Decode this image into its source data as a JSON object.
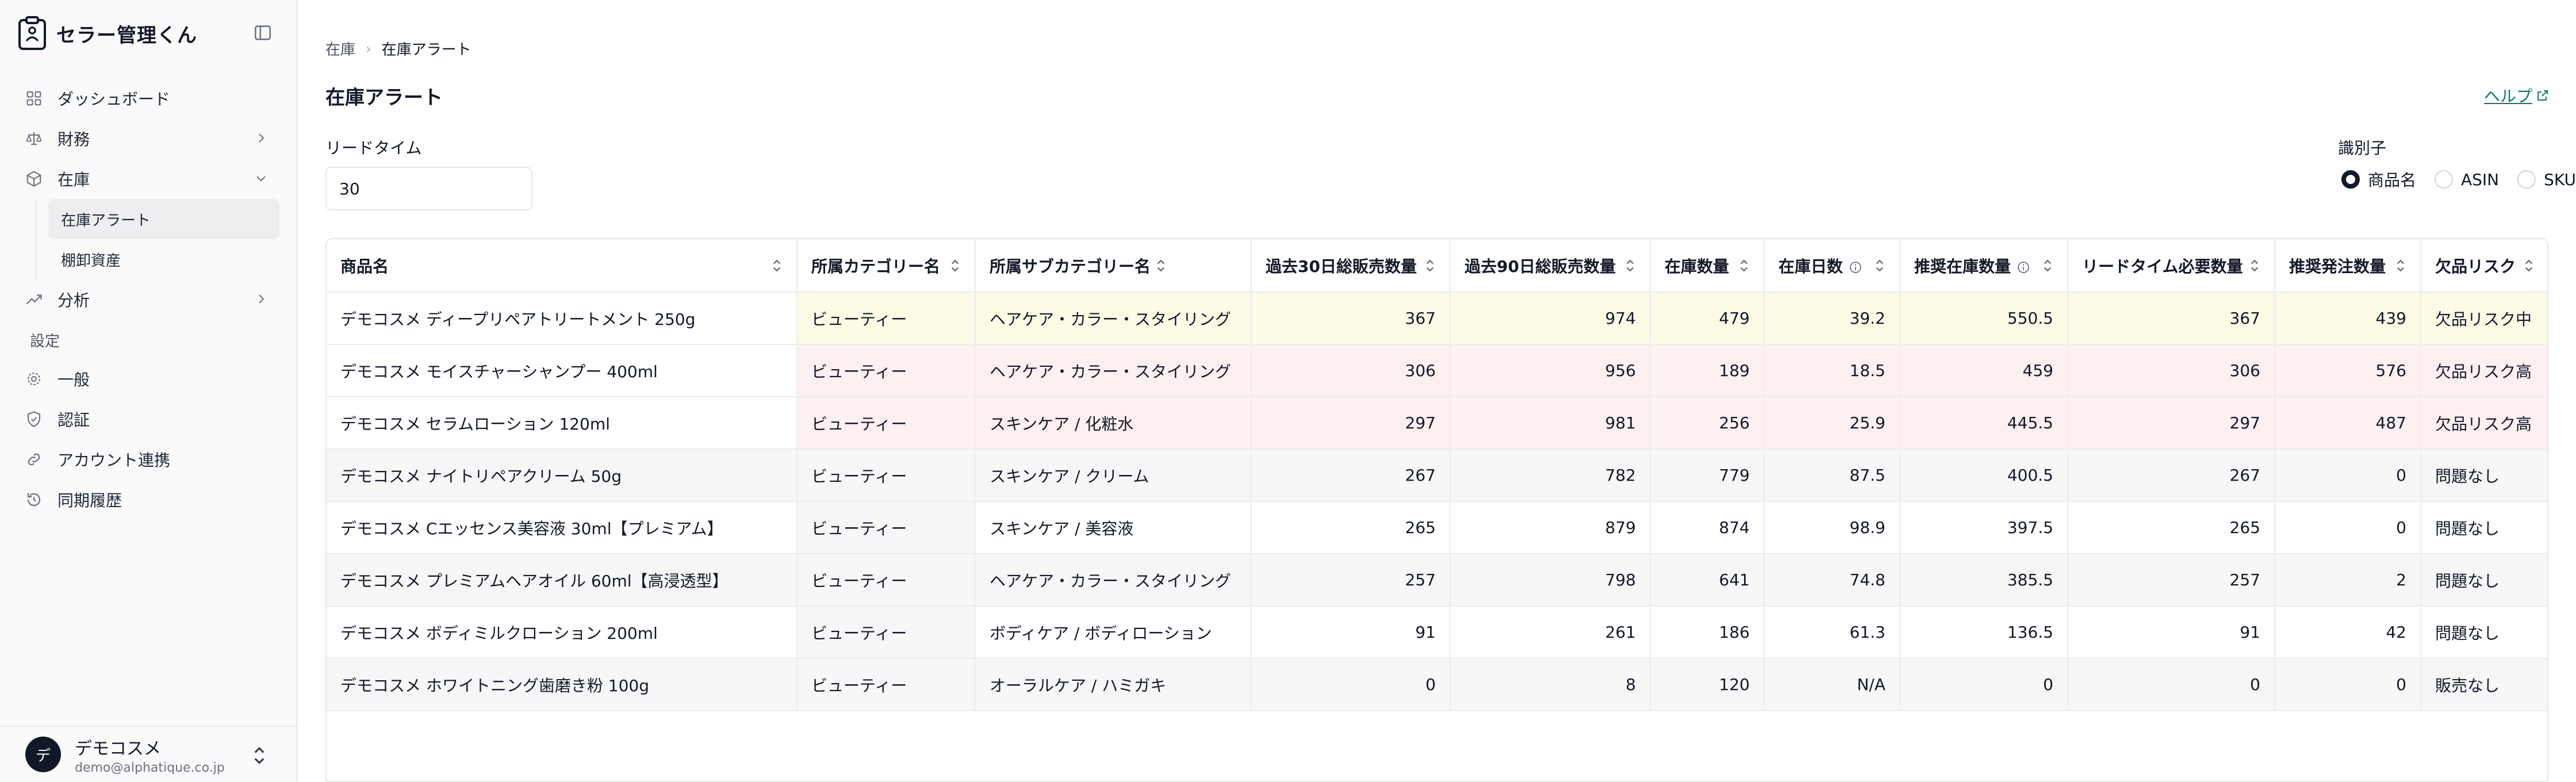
{
  "app": {
    "name": "セラー管理くん"
  },
  "sidebar": {
    "items": [
      {
        "label": "ダッシュボード",
        "icon": "grid-icon"
      },
      {
        "label": "財務",
        "icon": "scale-icon"
      },
      {
        "label": "在庫",
        "icon": "box-icon"
      },
      {
        "label": "分析",
        "icon": "trend-icon"
      }
    ],
    "inventory_sub": [
      {
        "label": "在庫アラート"
      },
      {
        "label": "棚卸資産"
      }
    ],
    "settings_heading": "設定",
    "settings_items": [
      {
        "label": "一般",
        "icon": "gear-icon"
      },
      {
        "label": "認証",
        "icon": "shield-icon"
      },
      {
        "label": "アカウント連携",
        "icon": "link-icon"
      },
      {
        "label": "同期履歴",
        "icon": "history-icon"
      }
    ]
  },
  "user": {
    "avatar_initial": "デ",
    "name": "デモコスメ",
    "email": "demo@alphatique.co.jp"
  },
  "breadcrumb": {
    "parent": "在庫",
    "separator": "›",
    "current": "在庫アラート"
  },
  "page": {
    "title": "在庫アラート",
    "help_label": "ヘルプ"
  },
  "lead_time": {
    "label": "リードタイム",
    "value": "30"
  },
  "identifier": {
    "label": "識別子",
    "options": [
      "商品名",
      "ASIN",
      "SKU"
    ],
    "selected": "商品名"
  },
  "table": {
    "headers": {
      "product": "商品名",
      "category": "所属カテゴリー名",
      "subcategory": "所属サブカテゴリー名",
      "sales30": "過去30日総販売数量",
      "sales90": "過去90日総販売数量",
      "stock": "在庫数量",
      "days": "在庫日数",
      "recommended": "推奨在庫数量",
      "leadtime_need": "リードタイム必要数量",
      "order": "推奨発注数量",
      "risk": "欠品リスク"
    },
    "rows": [
      {
        "product": "デモコスメ ディープリペアトリートメント 250g",
        "category": "ビューティー",
        "subcategory": "ヘアケア・カラー・スタイリング",
        "sales30": "367",
        "sales90": "974",
        "stock": "479",
        "days": "39.2",
        "recommended": "550.5",
        "leadtime_need": "367",
        "order": "439",
        "risk": "欠品リスク中",
        "level": "mid"
      },
      {
        "product": "デモコスメ モイスチャーシャンプー 400ml",
        "category": "ビューティー",
        "subcategory": "ヘアケア・カラー・スタイリング",
        "sales30": "306",
        "sales90": "956",
        "stock": "189",
        "days": "18.5",
        "recommended": "459",
        "leadtime_need": "306",
        "order": "576",
        "risk": "欠品リスク高",
        "level": "high"
      },
      {
        "product": "デモコスメ セラムローション 120ml",
        "category": "ビューティー",
        "subcategory": "スキンケア / 化粧水",
        "sales30": "297",
        "sales90": "981",
        "stock": "256",
        "days": "25.9",
        "recommended": "445.5",
        "leadtime_need": "297",
        "order": "487",
        "risk": "欠品リスク高",
        "level": "high"
      },
      {
        "product": "デモコスメ ナイトリペアクリーム 50g",
        "category": "ビューティー",
        "subcategory": "スキンケア / クリーム",
        "sales30": "267",
        "sales90": "782",
        "stock": "779",
        "days": "87.5",
        "recommended": "400.5",
        "leadtime_need": "267",
        "order": "0",
        "risk": "問題なし",
        "level": "alt"
      },
      {
        "product": "デモコスメ Cエッセンス美容液 30ml【プレミアム】",
        "category": "ビューティー",
        "subcategory": "スキンケア / 美容液",
        "sales30": "265",
        "sales90": "879",
        "stock": "874",
        "days": "98.9",
        "recommended": "397.5",
        "leadtime_need": "265",
        "order": "0",
        "risk": "問題なし",
        "level": "plain"
      },
      {
        "product": "デモコスメ プレミアムヘアオイル 60ml【高浸透型】",
        "category": "ビューティー",
        "subcategory": "ヘアケア・カラー・スタイリング",
        "sales30": "257",
        "sales90": "798",
        "stock": "641",
        "days": "74.8",
        "recommended": "385.5",
        "leadtime_need": "257",
        "order": "2",
        "risk": "問題なし",
        "level": "alt"
      },
      {
        "product": "デモコスメ ボディミルクローション 200ml",
        "category": "ビューティー",
        "subcategory": "ボディケア / ボディローション",
        "sales30": "91",
        "sales90": "261",
        "stock": "186",
        "days": "61.3",
        "recommended": "136.5",
        "leadtime_need": "91",
        "order": "42",
        "risk": "問題なし",
        "level": "plain"
      },
      {
        "product": "デモコスメ ホワイトニング歯磨き粉 100g",
        "category": "ビューティー",
        "subcategory": "オーラルケア / ハミガキ",
        "sales30": "0",
        "sales90": "8",
        "stock": "120",
        "days": "N/A",
        "recommended": "0",
        "leadtime_need": "0",
        "order": "0",
        "risk": "販売なし",
        "level": "alt"
      }
    ]
  },
  "colors": {
    "risk_mid_bg": "#fdfbe6",
    "risk_high_bg": "#fdf0f0",
    "alt_row_bg": "#f7f7f8",
    "help_link": "#0f766e"
  }
}
